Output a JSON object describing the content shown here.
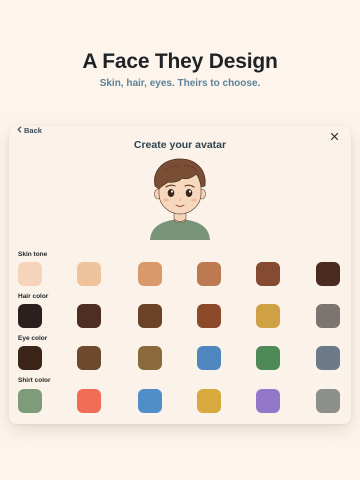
{
  "hero": {
    "title": "A Face They Design",
    "subtitle": "Skin, hair, eyes. Theirs to choose."
  },
  "dialog": {
    "back_label": "Back",
    "title": "Create your avatar"
  },
  "sections": [
    {
      "label": "Skin tone",
      "colors": [
        "#f6d4bb",
        "#efc49c",
        "#d89a6a",
        "#bd7a52",
        "#844b32",
        "#4b2a20"
      ]
    },
    {
      "label": "Hair color",
      "colors": [
        "#2a201e",
        "#4e2e21",
        "#6b4128",
        "#8d4a2b",
        "#cfa044",
        "#7b7470"
      ]
    },
    {
      "label": "Eye color",
      "colors": [
        "#3d2418",
        "#6d4a2e",
        "#8a6a3c",
        "#4f86bd",
        "#4e8a58",
        "#6d7a8a"
      ]
    },
    {
      "label": "Shirt color",
      "colors": [
        "#7e9c7a",
        "#ef6c55",
        "#4f8ec6",
        "#d7a93f",
        "#9377c8",
        "#8d8f8c"
      ]
    }
  ],
  "colors": {
    "background": "#fdf5ec",
    "card": "#fbf3ea",
    "accent_text": "#5b8298"
  },
  "icons": {
    "back": "chevron-left-icon",
    "close": "close-icon"
  }
}
